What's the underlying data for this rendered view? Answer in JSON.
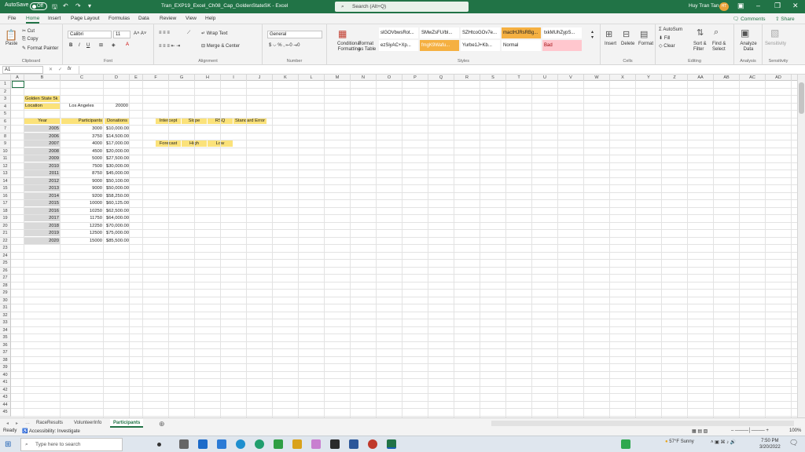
{
  "titlebar": {
    "autosave_label": "AutoSave",
    "autosave_state": "Off",
    "title": "Tran_EXP19_Excel_Ch08_Cap_GoldenStateSK  -  Excel",
    "search_placeholder": "Search (Alt+Q)",
    "user_name": "Huy Tran Tan",
    "user_initials": "HT"
  },
  "menu": {
    "tabs": [
      "File",
      "Home",
      "Insert",
      "Page Layout",
      "Formulas",
      "Data",
      "Review",
      "View",
      "Help"
    ],
    "active": "Home",
    "comments_label": "Comments",
    "share_label": "Share"
  },
  "ribbon": {
    "clipboard": {
      "paste": "Paste",
      "cut": "Cut",
      "copy": "Copy",
      "format_painter": "Format Painter",
      "label": "Clipboard"
    },
    "font": {
      "name": "Calibri",
      "size": "11",
      "label": "Font"
    },
    "alignment": {
      "wrap": "Wrap Text",
      "merge": "Merge & Center",
      "label": "Alignment"
    },
    "number": {
      "format": "General",
      "label": "Number"
    },
    "styles": {
      "conditional": "Conditional Formatting",
      "format_as_table": "Format as Table",
      "cells": [
        {
          "text": "slGOVbwsRot...",
          "bg": "#ffffff",
          "color": "#222222"
        },
        {
          "text": "SMwZsFU/bl...",
          "bg": "#ffffff",
          "color": "#222222"
        },
        {
          "text": "SZHtcoGOv7e...",
          "bg": "#ffffff",
          "color": "#222222"
        },
        {
          "text": "mactHJRsRBg...",
          "bg": "#f5b041",
          "color": "#222222"
        },
        {
          "text": "txkMUhZypS...",
          "bg": "#ffffff",
          "color": "#222222"
        },
        {
          "text": "ezSiyAC+Xp...",
          "bg": "#ffffff",
          "color": "#222222"
        },
        {
          "text": "fmgK9Wafu...",
          "bg": "#f5b041",
          "color": "#ffffff"
        },
        {
          "text": "Yurbe1J+Kb...",
          "bg": "#ffffff",
          "color": "#222222"
        },
        {
          "text": "Normal",
          "bg": "#ffffff",
          "color": "#222222"
        },
        {
          "text": "Bad",
          "bg": "#ffc7ce",
          "color": "#9c0006"
        }
      ],
      "label": "Styles"
    },
    "cells_group": {
      "insert": "Insert",
      "delete": "Delete",
      "format": "Format",
      "label": "Cells"
    },
    "editing": {
      "autosum": "AutoSum",
      "fill": "Fill",
      "clear": "Clear",
      "sort": "Sort & Filter",
      "find": "Find & Select",
      "label": "Editing"
    },
    "analysis": {
      "analyze": "Analyze Data",
      "label": "Analysis"
    },
    "sensitivity": {
      "sensitivity": "Sensitivity",
      "label": "Sensitivity"
    }
  },
  "formula_bar": {
    "namebox": "A1",
    "fx": "fx",
    "value": ""
  },
  "columns": [
    "A",
    "B",
    "C",
    "D",
    "E",
    "F",
    "G",
    "H",
    "I",
    "J",
    "K",
    "L",
    "M",
    "N",
    "O",
    "P",
    "Q",
    "R",
    "S",
    "T",
    "U",
    "V",
    "W",
    "X",
    "Y",
    "Z",
    "AA",
    "AB",
    "AC",
    "AD"
  ],
  "sheet": {
    "title": "Golden State 5k",
    "location_label": "Location",
    "location_value": "Los Angeles",
    "location_number": "20000",
    "headers": {
      "year": "Year",
      "participants": "Participants",
      "donations": "Donations"
    },
    "rows": [
      {
        "year": "2005",
        "participants": "3000",
        "donations": "$10,000.00"
      },
      {
        "year": "2006",
        "participants": "3750",
        "donations": "$14,500.00"
      },
      {
        "year": "2007",
        "participants": "4000",
        "donations": "$17,000.00"
      },
      {
        "year": "2008",
        "participants": "4500",
        "donations": "$20,000.00"
      },
      {
        "year": "2009",
        "participants": "5000",
        "donations": "$27,500.00"
      },
      {
        "year": "2010",
        "participants": "7500",
        "donations": "$30,000.00"
      },
      {
        "year": "2011",
        "participants": "8750",
        "donations": "$45,000.00"
      },
      {
        "year": "2012",
        "participants": "9000",
        "donations": "$50,100.00"
      },
      {
        "year": "2013",
        "participants": "9000",
        "donations": "$50,000.00"
      },
      {
        "year": "2014",
        "participants": "9200",
        "donations": "$58,250.00"
      },
      {
        "year": "2015",
        "participants": "10000",
        "donations": "$60,125.00"
      },
      {
        "year": "2016",
        "participants": "10250",
        "donations": "$62,500.00"
      },
      {
        "year": "2017",
        "participants": "11750",
        "donations": "$64,000.00"
      },
      {
        "year": "2018",
        "participants": "12250",
        "donations": "$70,000.00"
      },
      {
        "year": "2019",
        "participants": "12500",
        "donations": "$75,000.00"
      },
      {
        "year": "2020",
        "participants": "15000",
        "donations": "$85,500.00"
      }
    ],
    "stats_headers": [
      "Intercept",
      "Slope",
      "RSQ",
      "Standard Error"
    ],
    "forecast_headers": [
      "Forecast",
      "High",
      "Low"
    ]
  },
  "sheet_tabs": [
    "RaceResults",
    "VolunteerInfo",
    "Participants"
  ],
  "active_sheet": "Participants",
  "status": {
    "ready": "Ready",
    "accessibility": "Accessibility: Investigate",
    "zoom": "100%"
  },
  "taskbar": {
    "search_placeholder": "Type here to search",
    "weather": "57°F  Sunny",
    "time": "7:50 PM",
    "date": "3/20/2022"
  },
  "colors": {
    "excel_green": "#217346",
    "highlight_yellow": "#fbe27a",
    "shade_gray": "#d9d9d9"
  }
}
